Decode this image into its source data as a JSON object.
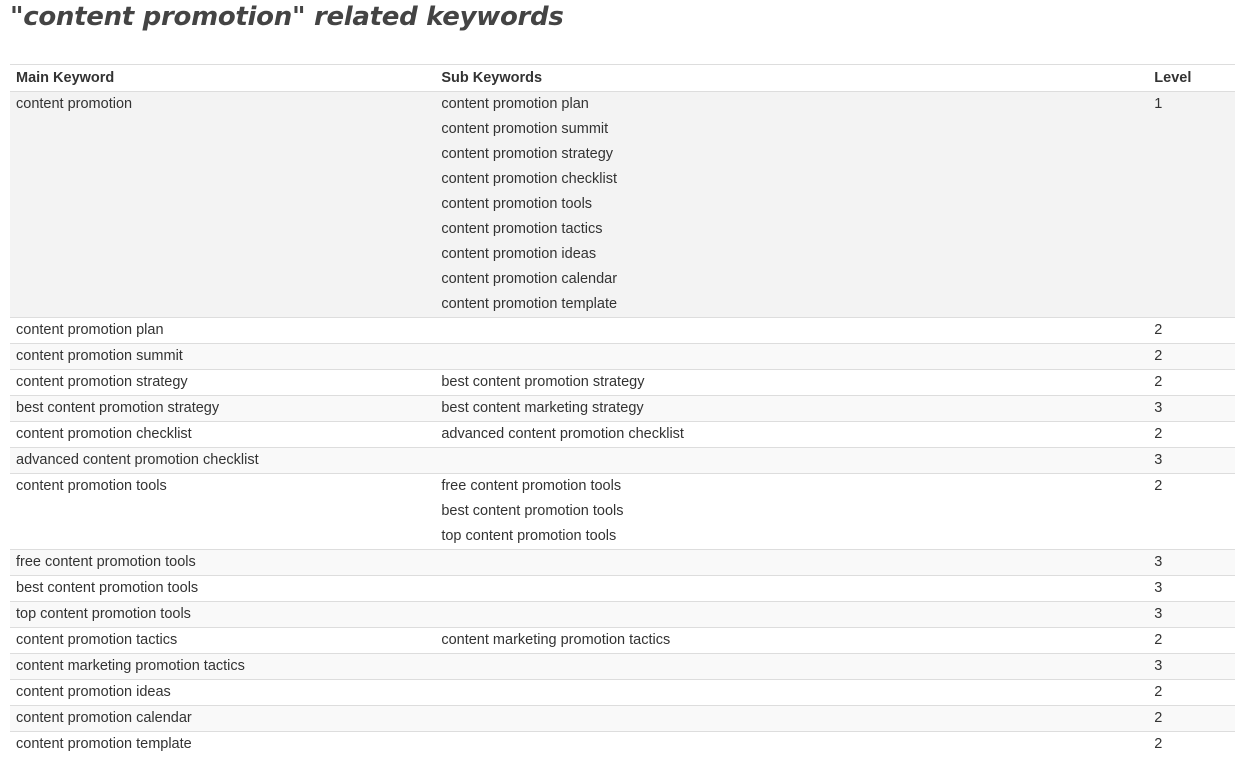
{
  "title": "\"content promotion\" related keywords",
  "table": {
    "headers": {
      "main": "Main Keyword",
      "sub": "Sub Keywords",
      "level": "Level"
    },
    "rows": [
      {
        "main": "content promotion",
        "level": "1",
        "sub": [
          "content promotion plan",
          "content promotion summit",
          "content promotion strategy",
          "content promotion checklist",
          "content promotion tools",
          "content promotion tactics",
          "content promotion ideas",
          "content promotion calendar",
          "content promotion template"
        ]
      },
      {
        "main": "content promotion plan",
        "level": "2",
        "sub": []
      },
      {
        "main": "content promotion summit",
        "level": "2",
        "sub": []
      },
      {
        "main": "content promotion strategy",
        "level": "2",
        "sub": [
          "best content promotion strategy"
        ]
      },
      {
        "main": "best content promotion strategy",
        "level": "3",
        "sub": [
          "best content marketing strategy"
        ]
      },
      {
        "main": "content promotion checklist",
        "level": "2",
        "sub": [
          "advanced content promotion checklist"
        ]
      },
      {
        "main": "advanced content promotion checklist",
        "level": "3",
        "sub": []
      },
      {
        "main": "content promotion tools",
        "level": "2",
        "sub": [
          "free content promotion tools",
          "best content promotion tools",
          "top content promotion tools"
        ]
      },
      {
        "main": "free content promotion tools",
        "level": "3",
        "sub": []
      },
      {
        "main": "best content promotion tools",
        "level": "3",
        "sub": []
      },
      {
        "main": "top content promotion tools",
        "level": "3",
        "sub": []
      },
      {
        "main": "content promotion tactics",
        "level": "2",
        "sub": [
          "content marketing promotion tactics"
        ]
      },
      {
        "main": "content marketing promotion tactics",
        "level": "3",
        "sub": []
      },
      {
        "main": "content promotion ideas",
        "level": "2",
        "sub": []
      },
      {
        "main": "content promotion calendar",
        "level": "2",
        "sub": []
      },
      {
        "main": "content promotion template",
        "level": "2",
        "sub": []
      }
    ]
  },
  "colors": {
    "text": "#333333",
    "title": "#444444",
    "border": "#dddddd",
    "stripe": "#f9f9f9",
    "active_row": "#f3f3f3"
  }
}
